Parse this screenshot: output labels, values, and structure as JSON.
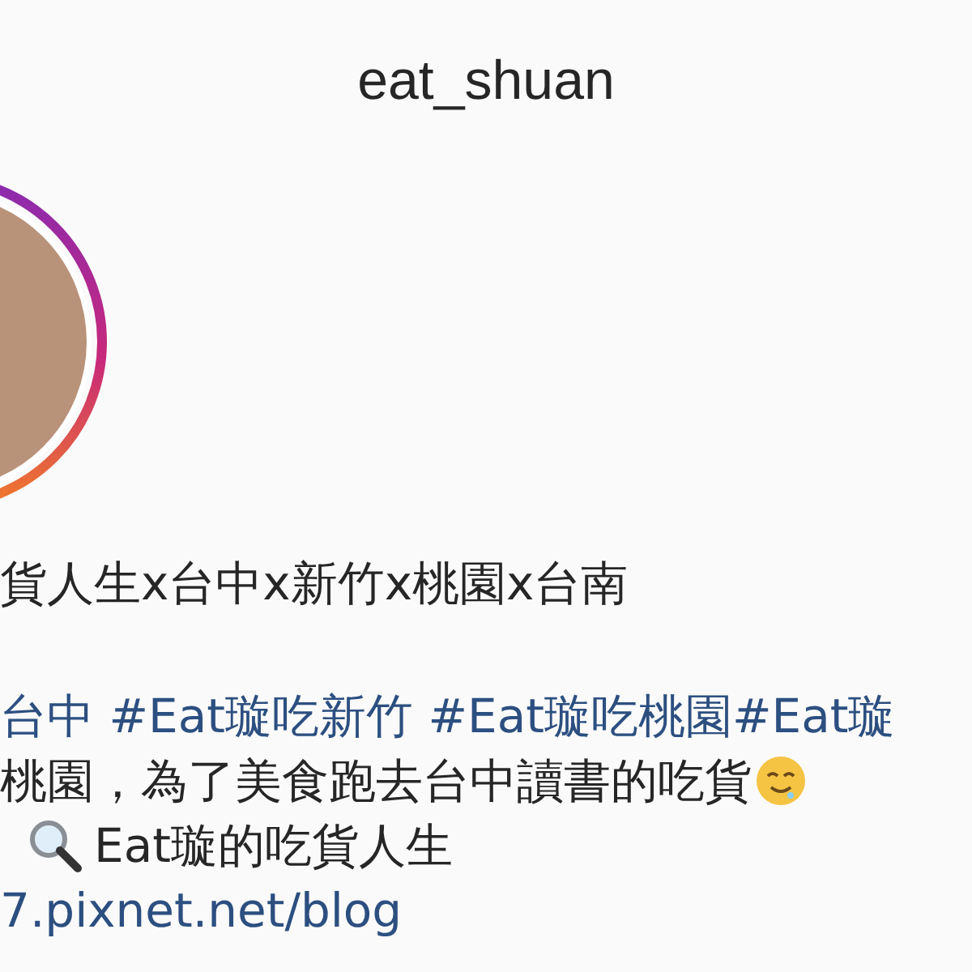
{
  "header": {
    "username": "eat_shuan"
  },
  "bio": {
    "name": "貨人生x台中x新竹x桃園x台南",
    "hashtags": "台中 #Eat璇吃新竹 #Eat璇吃桃園#Eat璇",
    "description": "桃園，為了美食跑去台中讀書的吃貨",
    "blog_title": "Eat璇的吃貨人生",
    "link": "7.pixnet.net/blog"
  }
}
